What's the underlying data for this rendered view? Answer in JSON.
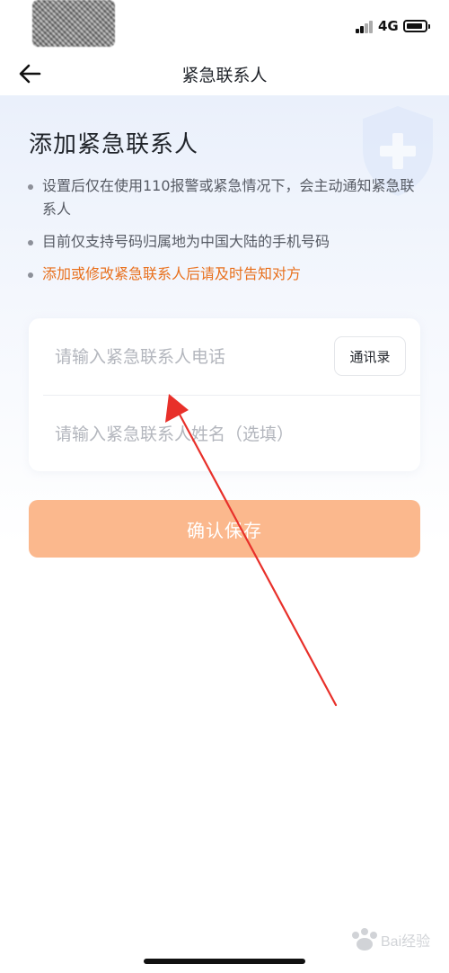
{
  "status_bar": {
    "network": "4G"
  },
  "nav": {
    "title": "紧急联系人"
  },
  "page": {
    "title": "添加紧急联系人",
    "tips": [
      "设置后仅在使用110报警或紧急情况下，会主动通知紧急联系人",
      "目前仅支持号码归属地为中国大陆的手机号码",
      "添加或修改紧急联系人后请及时告知对方"
    ]
  },
  "form": {
    "phone_placeholder": "请输入紧急联系人电话",
    "phone_value": "",
    "contacts_label": "通讯录",
    "name_placeholder": "请输入紧急联系人姓名（选填）",
    "name_value": ""
  },
  "actions": {
    "save_label": "确认保存"
  },
  "watermark": {
    "text": "Bai经验"
  },
  "colors": {
    "accent_orange": "#e8701d",
    "save_button": "#fbb88d",
    "annotation_red": "#e8302a",
    "background_tint": "#eaf0fb"
  },
  "icons": {
    "back": "arrow-left-icon",
    "shield": "shield-plus-icon",
    "signal": "signal-bars-icon",
    "battery": "battery-icon"
  }
}
